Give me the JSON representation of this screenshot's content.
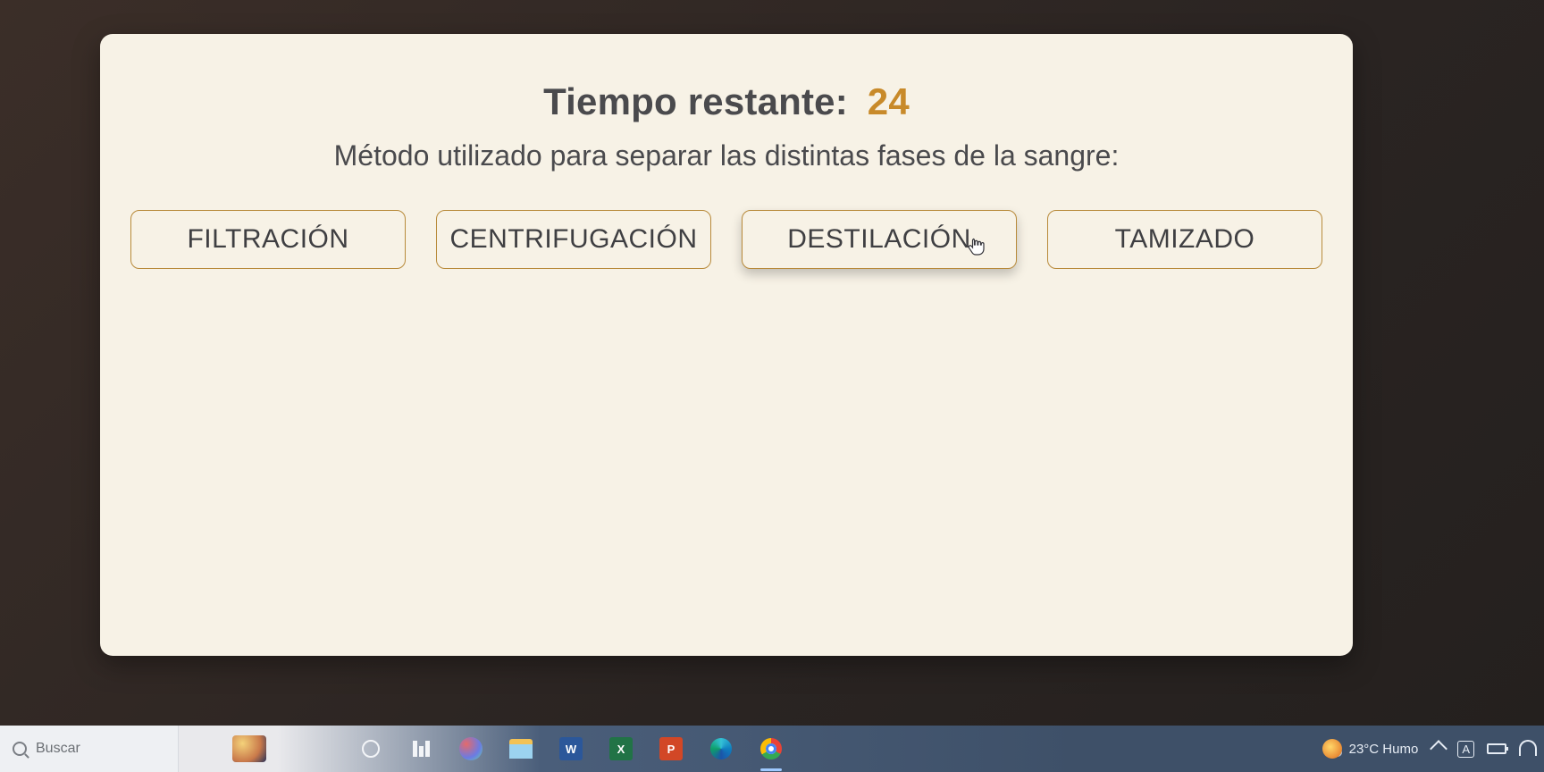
{
  "quiz": {
    "timer_label": "Tiempo restante:",
    "timer_value": "24",
    "question": "Método utilizado para separar las distintas fases de la sangre:",
    "answers": [
      "FILTRACIÓN",
      "CENTRIFUGACIÓN",
      "DESTILACIÓN",
      "TAMIZADO"
    ],
    "hovered_index": 2
  },
  "taskbar": {
    "search_placeholder": "Buscar",
    "weather_text": "23°C Humo"
  }
}
